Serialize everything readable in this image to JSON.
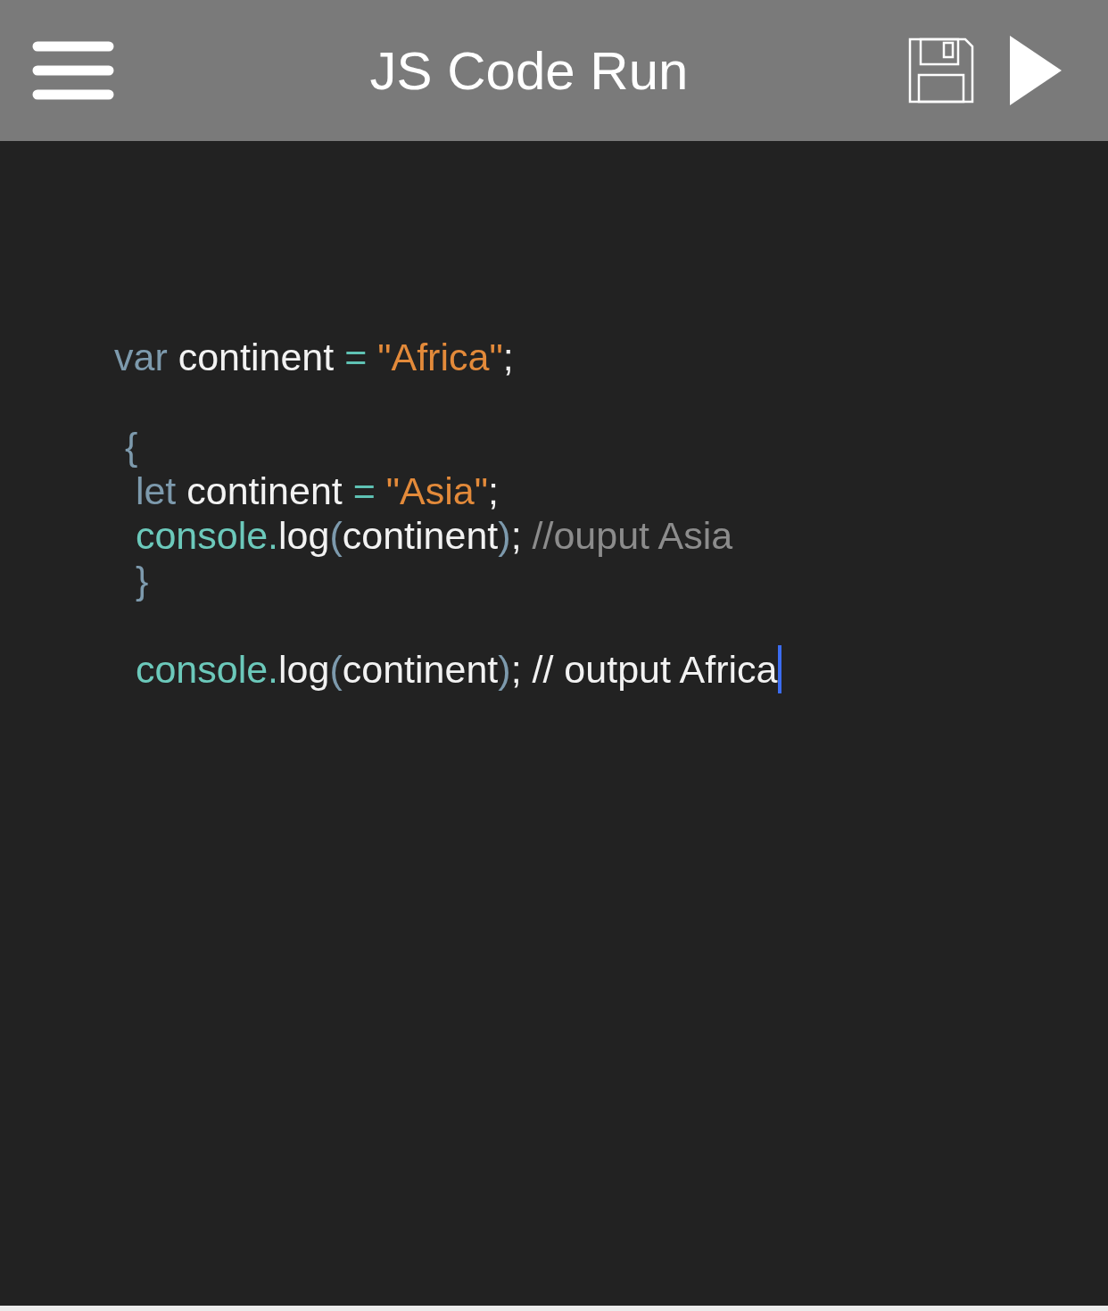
{
  "header": {
    "title": "JS Code Run"
  },
  "editor": {
    "cursor": true,
    "lines": [
      {
        "kind": "code",
        "tokens": [
          {
            "kind": "keyword",
            "text": "var"
          },
          {
            "kind": "plain",
            "text": " continent "
          },
          {
            "kind": "operator",
            "text": "="
          },
          {
            "kind": "string",
            "text": " \"Africa\""
          },
          {
            "kind": "plain",
            "text": ";"
          }
        ]
      },
      {
        "kind": "blank"
      },
      {
        "kind": "code",
        "tokens": [
          {
            "kind": "punct",
            "text": " {"
          }
        ]
      },
      {
        "kind": "code",
        "tokens": [
          {
            "kind": "keyword",
            "text": "  let"
          },
          {
            "kind": "plain",
            "text": " continent "
          },
          {
            "kind": "operator",
            "text": "="
          },
          {
            "kind": "string",
            "text": " \"Asia\""
          },
          {
            "kind": "plain",
            "text": ";"
          }
        ]
      },
      {
        "kind": "code",
        "tokens": [
          {
            "kind": "object",
            "text": "  console."
          },
          {
            "kind": "plain",
            "text": "log"
          },
          {
            "kind": "punct",
            "text": "("
          },
          {
            "kind": "plain",
            "text": "continent"
          },
          {
            "kind": "punct",
            "text": ")"
          },
          {
            "kind": "plain",
            "text": "; "
          },
          {
            "kind": "comment",
            "text": "//ouput Asia"
          }
        ]
      },
      {
        "kind": "code",
        "tokens": [
          {
            "kind": "punct",
            "text": "  }"
          }
        ]
      },
      {
        "kind": "blank"
      },
      {
        "kind": "code",
        "tokens": [
          {
            "kind": "object",
            "text": "  console."
          },
          {
            "kind": "plain",
            "text": "log"
          },
          {
            "kind": "punct",
            "text": "("
          },
          {
            "kind": "plain",
            "text": "continent"
          },
          {
            "kind": "punct",
            "text": ")"
          },
          {
            "kind": "plain",
            "text": "; // output Africa"
          }
        ]
      }
    ]
  }
}
